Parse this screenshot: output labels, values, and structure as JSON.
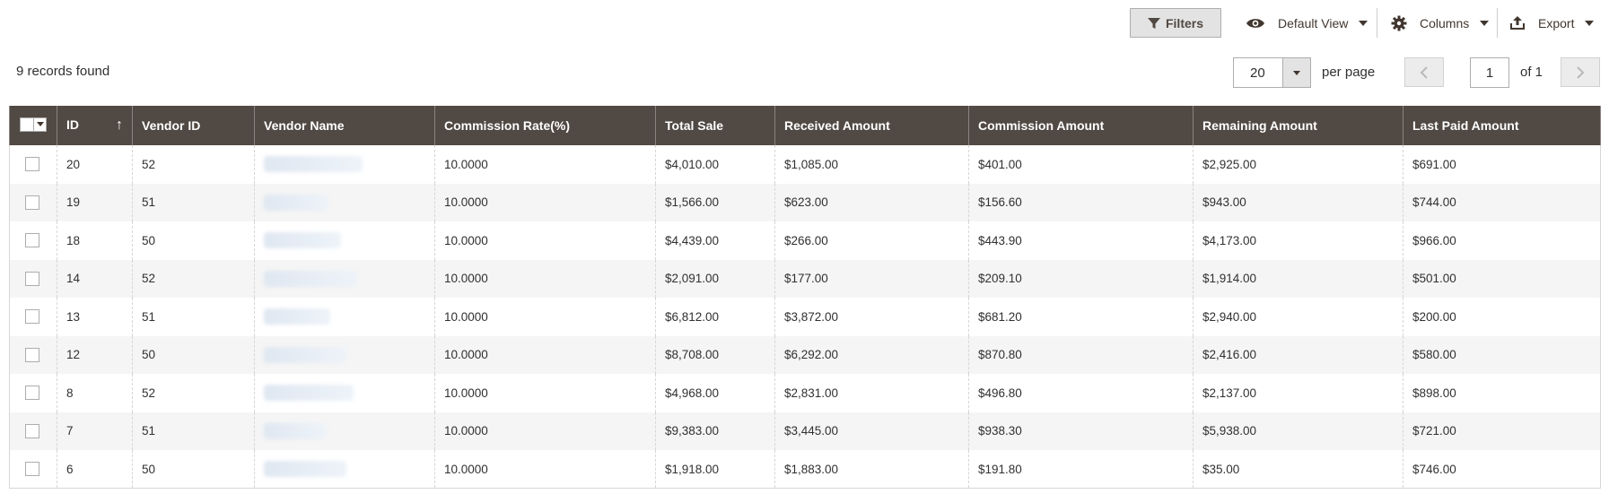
{
  "toolbar": {
    "filters_label": "Filters",
    "view_label": "Default View",
    "columns_label": "Columns",
    "export_label": "Export"
  },
  "summary": {
    "records_text": "9 records found"
  },
  "pagination": {
    "per_page_value": "20",
    "per_page_label": "per page",
    "current_page": "1",
    "of_pages": "of 1"
  },
  "grid": {
    "headers": [
      "ID",
      "Vendor ID",
      "Vendor Name",
      "Commission Rate(%)",
      "Total Sale",
      "Received Amount",
      "Commission Amount",
      "Remaining Amount",
      "Last Paid Amount"
    ],
    "rows": [
      {
        "id": "20",
        "vendor_id": "52",
        "commission_rate": "10.0000",
        "total_sale": "$4,010.00",
        "received": "$1,085.00",
        "commission": "$401.00",
        "remaining": "$2,925.00",
        "last_paid": "$691.00"
      },
      {
        "id": "19",
        "vendor_id": "51",
        "commission_rate": "10.0000",
        "total_sale": "$1,566.00",
        "received": "$623.00",
        "commission": "$156.60",
        "remaining": "$943.00",
        "last_paid": "$744.00"
      },
      {
        "id": "18",
        "vendor_id": "50",
        "commission_rate": "10.0000",
        "total_sale": "$4,439.00",
        "received": "$266.00",
        "commission": "$443.90",
        "remaining": "$4,173.00",
        "last_paid": "$966.00"
      },
      {
        "id": "14",
        "vendor_id": "52",
        "commission_rate": "10.0000",
        "total_sale": "$2,091.00",
        "received": "$177.00",
        "commission": "$209.10",
        "remaining": "$1,914.00",
        "last_paid": "$501.00"
      },
      {
        "id": "13",
        "vendor_id": "51",
        "commission_rate": "10.0000",
        "total_sale": "$6,812.00",
        "received": "$3,872.00",
        "commission": "$681.20",
        "remaining": "$2,940.00",
        "last_paid": "$200.00"
      },
      {
        "id": "12",
        "vendor_id": "50",
        "commission_rate": "10.0000",
        "total_sale": "$8,708.00",
        "received": "$6,292.00",
        "commission": "$870.80",
        "remaining": "$2,416.00",
        "last_paid": "$580.00"
      },
      {
        "id": "8",
        "vendor_id": "52",
        "commission_rate": "10.0000",
        "total_sale": "$4,968.00",
        "received": "$2,831.00",
        "commission": "$496.80",
        "remaining": "$2,137.00",
        "last_paid": "$898.00"
      },
      {
        "id": "7",
        "vendor_id": "51",
        "commission_rate": "10.0000",
        "total_sale": "$9,383.00",
        "received": "$3,445.00",
        "commission": "$938.30",
        "remaining": "$5,938.00",
        "last_paid": "$721.00"
      },
      {
        "id": "6",
        "vendor_id": "50",
        "commission_rate": "10.0000",
        "total_sale": "$1,918.00",
        "received": "$1,883.00",
        "commission": "$191.80",
        "remaining": "$35.00",
        "last_paid": "$746.00"
      }
    ]
  },
  "colors": {
    "header_bg": "#514943",
    "header_text": "#ffffff",
    "alt_row": "#f5f5f5",
    "filters_bg": "#e3e3e3"
  },
  "icons": [
    "filter-icon",
    "eye-icon",
    "gear-icon",
    "export-icon",
    "chevron-left-icon",
    "chevron-right-icon",
    "sort-up-icon"
  ]
}
